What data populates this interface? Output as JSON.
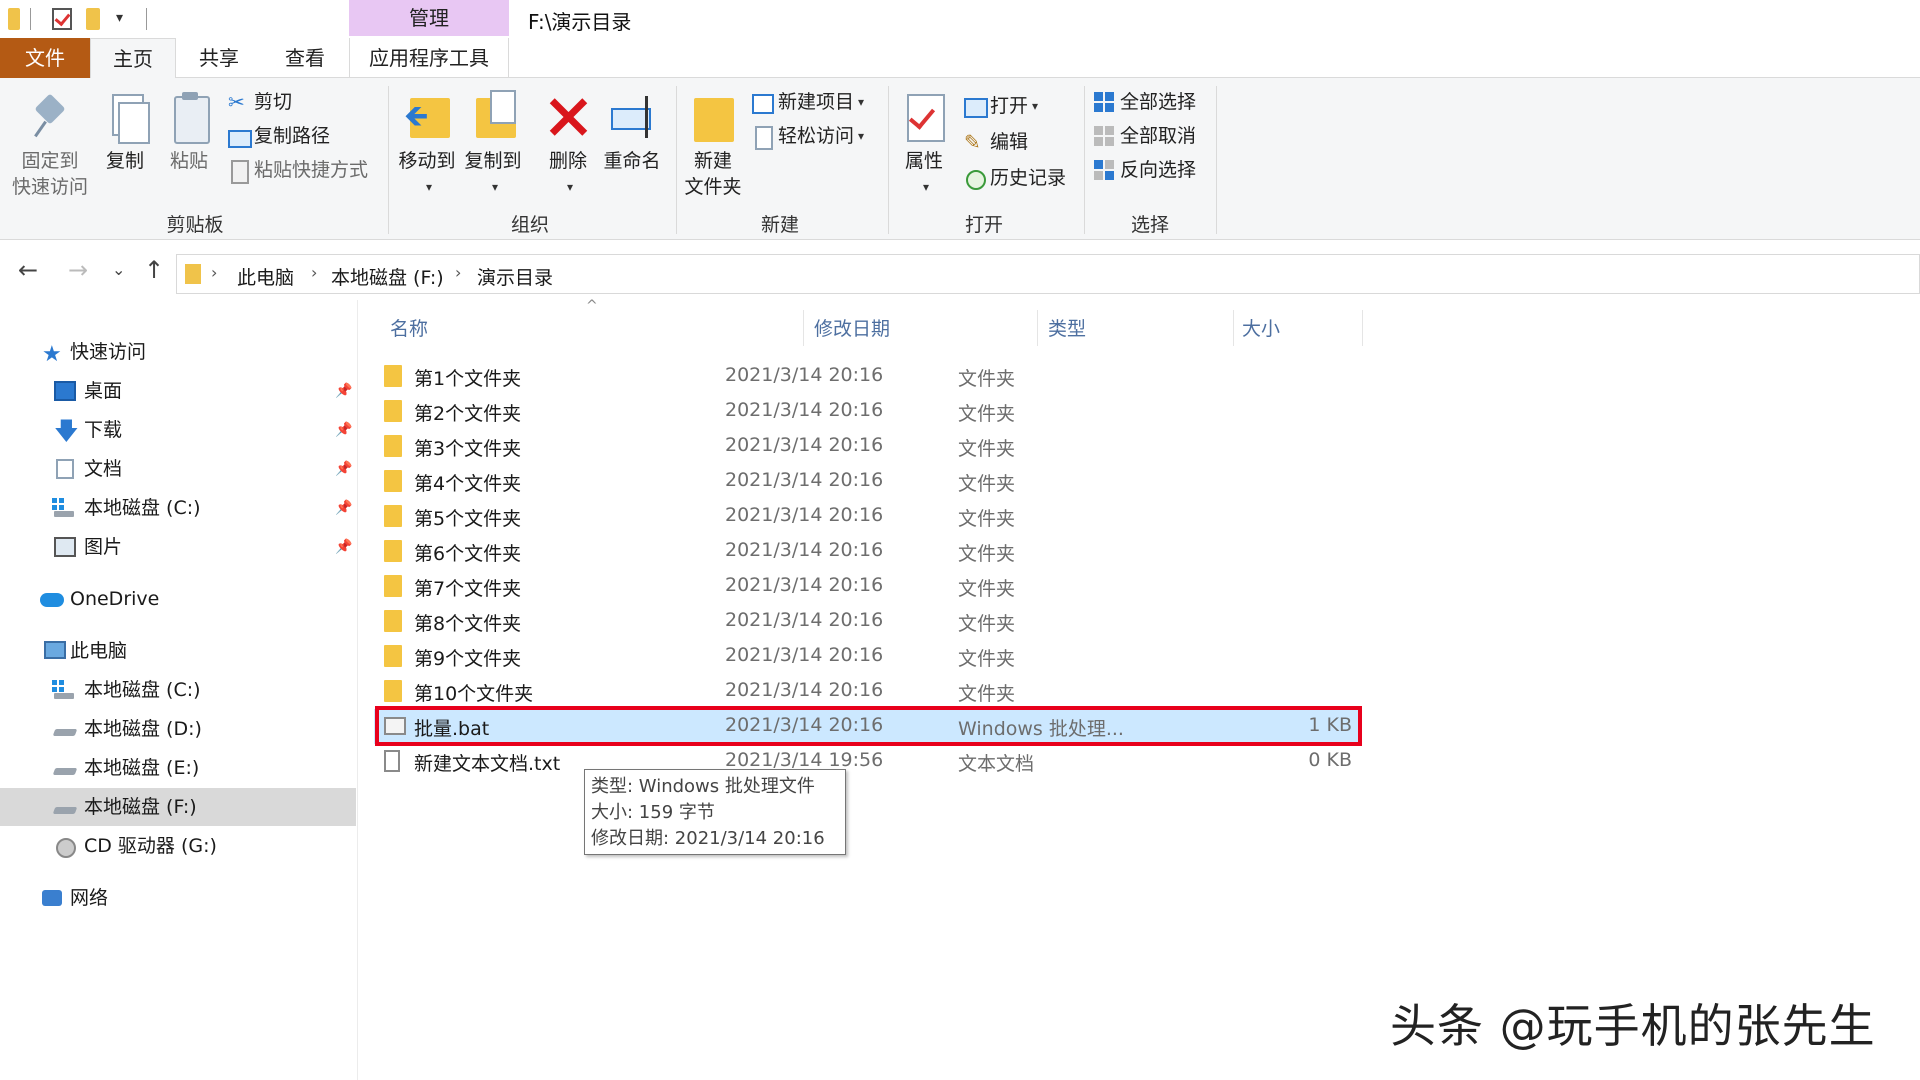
{
  "window": {
    "title": "F:\\演示目录",
    "context_tab": "管理"
  },
  "ribbon_tabs": {
    "file": "文件",
    "home": "主页",
    "share": "共享",
    "view": "查看",
    "app_tools": "应用程序工具"
  },
  "ribbon": {
    "clipboard": {
      "label": "剪贴板",
      "pin_l1": "固定到",
      "pin_l2": "快速访问",
      "copy": "复制",
      "paste": "粘贴",
      "cut": "剪切",
      "copy_path": "复制路径",
      "paste_shortcut": "粘贴快捷方式"
    },
    "organize": {
      "label": "组织",
      "move_to": "移动到",
      "copy_to": "复制到",
      "delete": "删除",
      "rename": "重命名"
    },
    "new": {
      "label": "新建",
      "new_folder_l1": "新建",
      "new_folder_l2": "文件夹",
      "new_item": "新建项目",
      "easy_access": "轻松访问"
    },
    "open": {
      "label": "打开",
      "properties": "属性",
      "open": "打开",
      "edit": "编辑",
      "history": "历史记录"
    },
    "select": {
      "label": "选择",
      "select_all": "全部选择",
      "select_none": "全部取消",
      "invert": "反向选择"
    }
  },
  "address": {
    "crumbs": [
      "此电脑",
      "本地磁盘 (F:)",
      "演示目录"
    ]
  },
  "sidebar": {
    "quick_access": "快速访问",
    "quick_items": [
      "桌面",
      "下载",
      "文档",
      "本地磁盘 (C:)",
      "图片"
    ],
    "onedrive": "OneDrive",
    "this_pc": "此电脑",
    "drives": [
      "本地磁盘 (C:)",
      "本地磁盘 (D:)",
      "本地磁盘 (E:)",
      "本地磁盘 (F:)",
      "CD 驱动器 (G:)"
    ],
    "network": "网络"
  },
  "columns": {
    "name": "名称",
    "date": "修改日期",
    "type": "类型",
    "size": "大小"
  },
  "files": [
    {
      "name": "第1个文件夹",
      "date": "2021/3/14 20:16",
      "type": "文件夹",
      "size": ""
    },
    {
      "name": "第2个文件夹",
      "date": "2021/3/14 20:16",
      "type": "文件夹",
      "size": ""
    },
    {
      "name": "第3个文件夹",
      "date": "2021/3/14 20:16",
      "type": "文件夹",
      "size": ""
    },
    {
      "name": "第4个文件夹",
      "date": "2021/3/14 20:16",
      "type": "文件夹",
      "size": ""
    },
    {
      "name": "第5个文件夹",
      "date": "2021/3/14 20:16",
      "type": "文件夹",
      "size": ""
    },
    {
      "name": "第6个文件夹",
      "date": "2021/3/14 20:16",
      "type": "文件夹",
      "size": ""
    },
    {
      "name": "第7个文件夹",
      "date": "2021/3/14 20:16",
      "type": "文件夹",
      "size": ""
    },
    {
      "name": "第8个文件夹",
      "date": "2021/3/14 20:16",
      "type": "文件夹",
      "size": ""
    },
    {
      "name": "第9个文件夹",
      "date": "2021/3/14 20:16",
      "type": "文件夹",
      "size": ""
    },
    {
      "name": "第10个文件夹",
      "date": "2021/3/14 20:16",
      "type": "文件夹",
      "size": ""
    },
    {
      "name": "批量.bat",
      "date": "2021/3/14 20:16",
      "type": "Windows 批处理...",
      "size": "1 KB"
    },
    {
      "name": "新建文本文档.txt",
      "date": "2021/3/14 19:56",
      "type": "文本文档",
      "size": "0 KB"
    }
  ],
  "tooltip": {
    "type": "类型: Windows 批处理文件",
    "size": "大小: 159 字节",
    "modified": "修改日期: 2021/3/14 20:16"
  },
  "watermark": "头条 @玩手机的张先生",
  "colors": {
    "file_tab": "#b45a14",
    "manage_tab": "#e8c7f3",
    "selected_row": "#cce8ff",
    "highlight_border": "#e8001c"
  }
}
